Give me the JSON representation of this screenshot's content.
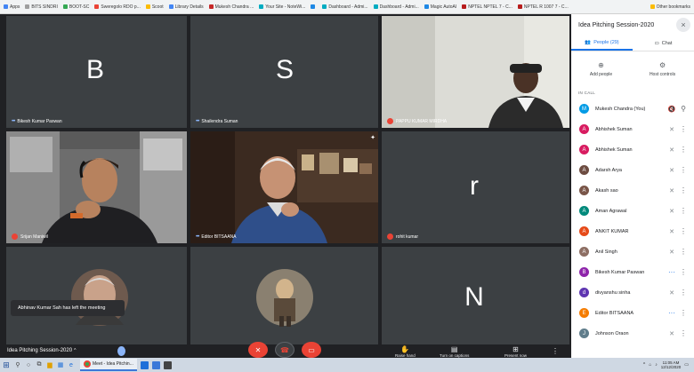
{
  "bookmarks": [
    "Apps",
    "BITS SINDRI",
    "BOOT-SC",
    "Sweregolo RDO p...",
    "Scoot",
    "Library Details",
    "Mukesh Chandra ...",
    "Your Site - NoteWi...",
    "",
    "Dashboard - Admi...",
    "Dashboard - Admi...",
    "Magic AutoAI",
    "NPTEL NPTEL 7 - C...",
    "NPTEL R 1007 7 - C...",
    "Other bookmarks"
  ],
  "stage": {
    "tiles": [
      {
        "name": "Bikesh Kumar Paswan",
        "initial": "B",
        "avatar_color": "#8e24aa",
        "dots": true
      },
      {
        "name": "Shailendra Suman",
        "initial": "S",
        "avatar_color": "#e8551c",
        "dots": true
      },
      {
        "name": "PAPPU KUMAR MIRDHA",
        "muted": true
      },
      {
        "name": "Srijan Maniwil",
        "muted": true
      },
      {
        "name": "Editor BITSAANA",
        "dots": true
      },
      {
        "name": "rohit kumar",
        "initial": "r",
        "avatar_color": "#6d3b22",
        "muted": true
      },
      {
        "name": ""
      },
      {
        "name": ""
      },
      {
        "name": "",
        "initial": "N",
        "avatar_color": "#78909c"
      }
    ],
    "notice": "Abhinav Kumar Sah has left the meeting"
  },
  "bottombar": {
    "meeting_title": "Idea Pitching Session-2020",
    "raise_hand": "Raise hand",
    "turn_on_captions": "Turn on captions",
    "present_now": "Present now"
  },
  "panel": {
    "title": "Idea Pitching Session-2020",
    "tab_people": "People (29)",
    "tab_chat": "Chat",
    "add_people": "Add people",
    "host_controls": "Host controls",
    "in_call": "IN CALL",
    "participants": [
      {
        "name": "Mukesh Chandra (You)",
        "initial": "M",
        "color": "#039be5"
      },
      {
        "name": "Abhishek Suman",
        "initial": "A",
        "color": "#d81b60"
      },
      {
        "name": "Abhishek Suman",
        "initial": "A",
        "color": "#d81b60"
      },
      {
        "name": "Adarsh Arya",
        "initial": "A",
        "color": "#6d4c41"
      },
      {
        "name": "Akash sao",
        "initial": "A",
        "color": "#795548"
      },
      {
        "name": "Aman Agrawal",
        "initial": "A",
        "color": "#00897b"
      },
      {
        "name": "ANKIT KUMAR",
        "initial": "A",
        "color": "#e64a19"
      },
      {
        "name": "Anil Singh",
        "initial": "A",
        "color": "#8d6e63"
      },
      {
        "name": "Bikesh Kumar Paswan",
        "initial": "B",
        "color": "#8e24aa"
      },
      {
        "name": "divyanshu sinha",
        "initial": "d",
        "color": "#5e35b1"
      },
      {
        "name": "Editor BITSAANA",
        "initial": "E",
        "color": "#f57c00"
      },
      {
        "name": "Johnson Oraon",
        "initial": "J",
        "color": "#607d8b"
      }
    ]
  },
  "taskbar": {
    "app_label": "Meet - Idea Pitchin...",
    "time": "11:05 AM",
    "date": "12/12/2020"
  }
}
